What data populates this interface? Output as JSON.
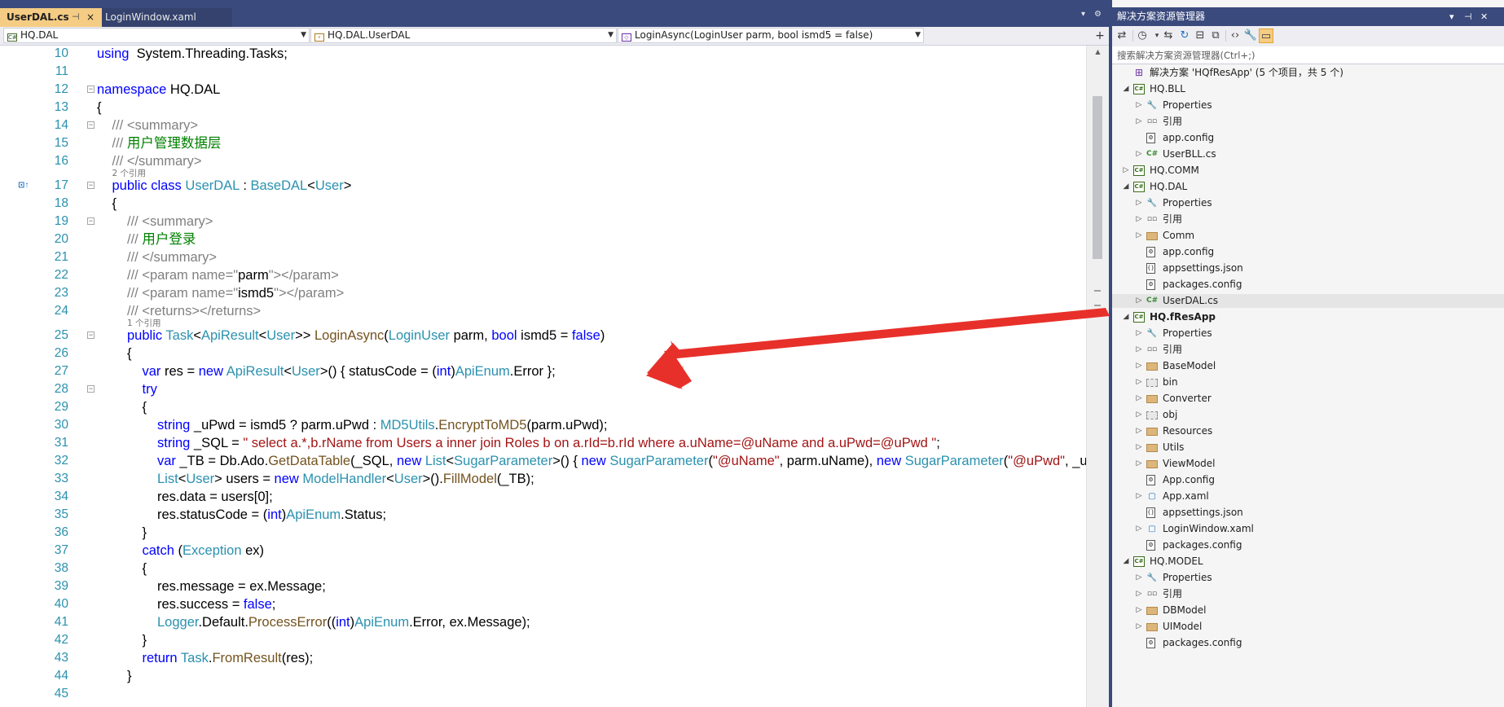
{
  "tabs": [
    {
      "label": "UserDAL.cs",
      "active": true,
      "pin": "⊣",
      "close": "×"
    },
    {
      "label": "LoginWindow.xaml",
      "active": false
    }
  ],
  "navbar": {
    "project": "HQ.DAL",
    "type": "HQ.DAL.UserDAL",
    "member": "LoginAsync(LoginUser parm, bool ismd5 = false)",
    "split_icon": "+"
  },
  "code_lines": [
    {
      "n": "10",
      "indent": 0,
      "tokens": [
        [
          "kw",
          "using"
        ],
        [
          "",
          "  System.Threading.Tasks;"
        ]
      ]
    },
    {
      "n": "11",
      "indent": 0,
      "tokens": []
    },
    {
      "n": "12",
      "indent": 0,
      "tokens": [
        [
          "kw",
          "namespace"
        ],
        [
          "",
          " HQ.DAL"
        ]
      ]
    },
    {
      "n": "13",
      "indent": 0,
      "tokens": [
        [
          "",
          "{"
        ]
      ]
    },
    {
      "n": "14",
      "indent": 1,
      "tokens": [
        [
          "doc",
          "/// "
        ],
        [
          "doc",
          "<summary>"
        ]
      ]
    },
    {
      "n": "15",
      "indent": 1,
      "tokens": [
        [
          "doc",
          "/// "
        ],
        [
          "cm",
          "用户管理数据层"
        ]
      ]
    },
    {
      "n": "16",
      "indent": 1,
      "tokens": [
        [
          "doc",
          "/// </summary>"
        ]
      ]
    },
    {
      "n": "17",
      "indent": 1,
      "tokens": [
        [
          "kw",
          "public"
        ],
        [
          "",
          " "
        ],
        [
          "kw",
          "class"
        ],
        [
          "",
          " "
        ],
        [
          "ty",
          "UserDAL"
        ],
        [
          "",
          " : "
        ],
        [
          "ty",
          "BaseDAL"
        ],
        [
          "",
          "<"
        ],
        [
          "ty",
          "User"
        ],
        [
          "",
          ">"
        ]
      ]
    },
    {
      "n": "18",
      "indent": 1,
      "tokens": [
        [
          "",
          "{"
        ]
      ]
    },
    {
      "n": "19",
      "indent": 2,
      "tokens": [
        [
          "doc",
          "/// <summary>"
        ]
      ]
    },
    {
      "n": "20",
      "indent": 2,
      "tokens": [
        [
          "doc",
          "/// "
        ],
        [
          "cm",
          "用户登录"
        ]
      ]
    },
    {
      "n": "21",
      "indent": 2,
      "tokens": [
        [
          "doc",
          "/// </summary>"
        ]
      ]
    },
    {
      "n": "22",
      "indent": 2,
      "tokens": [
        [
          "doc",
          "/// <param name=\""
        ],
        [
          "",
          "parm"
        ],
        [
          "doc",
          "\"></param>"
        ]
      ]
    },
    {
      "n": "23",
      "indent": 2,
      "tokens": [
        [
          "doc",
          "/// <param name=\""
        ],
        [
          "",
          "ismd5"
        ],
        [
          "doc",
          "\"></param>"
        ]
      ]
    },
    {
      "n": "24",
      "indent": 2,
      "tokens": [
        [
          "doc",
          "/// <returns></returns>"
        ]
      ]
    },
    {
      "n": "25",
      "indent": 2,
      "tokens": [
        [
          "kw",
          "public"
        ],
        [
          "",
          " "
        ],
        [
          "ty",
          "Task"
        ],
        [
          "",
          "<"
        ],
        [
          "ty",
          "ApiResult"
        ],
        [
          "",
          "<"
        ],
        [
          "ty",
          "User"
        ],
        [
          "",
          ">> "
        ],
        [
          "mt",
          "LoginAsync"
        ],
        [
          "",
          "("
        ],
        [
          "ty",
          "LoginUser"
        ],
        [
          "",
          " parm, "
        ],
        [
          "kw",
          "bool"
        ],
        [
          "",
          " ismd5 = "
        ],
        [
          "kw",
          "false"
        ],
        [
          "",
          ")"
        ]
      ]
    },
    {
      "n": "26",
      "indent": 2,
      "tokens": [
        [
          "",
          "{"
        ]
      ]
    },
    {
      "n": "27",
      "indent": 3,
      "tokens": [
        [
          "kw",
          "var"
        ],
        [
          "",
          " res = "
        ],
        [
          "kw",
          "new"
        ],
        [
          "",
          " "
        ],
        [
          "ty",
          "ApiResult"
        ],
        [
          "",
          "<"
        ],
        [
          "ty",
          "User"
        ],
        [
          "",
          ">() { statusCode = ("
        ],
        [
          "kw",
          "int"
        ],
        [
          "",
          ")"
        ],
        [
          "ty",
          "ApiEnum"
        ],
        [
          "",
          ".Error };"
        ]
      ]
    },
    {
      "n": "28",
      "indent": 3,
      "tokens": [
        [
          "kw",
          "try"
        ]
      ]
    },
    {
      "n": "29",
      "indent": 3,
      "tokens": [
        [
          "",
          "{"
        ]
      ]
    },
    {
      "n": "30",
      "indent": 4,
      "tokens": [
        [
          "kw",
          "string"
        ],
        [
          "",
          " _uPwd = ismd5 ? parm.uPwd : "
        ],
        [
          "ty",
          "MD5Utils"
        ],
        [
          "",
          "."
        ],
        [
          "mt",
          "EncryptToMD5"
        ],
        [
          "",
          "(parm.uPwd);"
        ]
      ]
    },
    {
      "n": "31",
      "indent": 4,
      "tokens": [
        [
          "kw",
          "string"
        ],
        [
          "",
          " _SQL = "
        ],
        [
          "st",
          "\" select a.*,b.rName from Users a inner join Roles b on a.rId=b.rId where a.uName=@uName and a.uPwd=@uPwd \""
        ],
        [
          "",
          ";"
        ]
      ]
    },
    {
      "n": "32",
      "indent": 4,
      "tokens": [
        [
          "kw",
          "var"
        ],
        [
          "",
          " _TB = Db.Ado."
        ],
        [
          "mt",
          "GetDataTable"
        ],
        [
          "",
          "(_SQL, "
        ],
        [
          "kw",
          "new"
        ],
        [
          "",
          " "
        ],
        [
          "ty",
          "List"
        ],
        [
          "",
          "<"
        ],
        [
          "ty",
          "SugarParameter"
        ],
        [
          "",
          ">() { "
        ],
        [
          "kw",
          "new"
        ],
        [
          "",
          " "
        ],
        [
          "ty",
          "SugarParameter"
        ],
        [
          "",
          "("
        ],
        [
          "st",
          "\"@uName\""
        ],
        [
          "",
          ", parm.uName), "
        ],
        [
          "kw",
          "new"
        ],
        [
          "",
          " "
        ],
        [
          "ty",
          "SugarParameter"
        ],
        [
          "",
          "("
        ],
        [
          "st",
          "\"@uPwd\""
        ],
        [
          "",
          ", _uPwd) });"
        ]
      ]
    },
    {
      "n": "33",
      "indent": 4,
      "tokens": [
        [
          "ty",
          "List"
        ],
        [
          "",
          "<"
        ],
        [
          "ty",
          "User"
        ],
        [
          "",
          "> users = "
        ],
        [
          "kw",
          "new"
        ],
        [
          "",
          " "
        ],
        [
          "ty",
          "ModelHandler"
        ],
        [
          "",
          "<"
        ],
        [
          "ty",
          "User"
        ],
        [
          "",
          ">()."
        ],
        [
          "mt",
          "FillModel"
        ],
        [
          "",
          "(_TB);"
        ]
      ]
    },
    {
      "n": "34",
      "indent": 4,
      "tokens": [
        [
          "",
          "res.data = users[0];"
        ]
      ]
    },
    {
      "n": "35",
      "indent": 4,
      "tokens": [
        [
          "",
          "res.statusCode = ("
        ],
        [
          "kw",
          "int"
        ],
        [
          "",
          ")"
        ],
        [
          "ty",
          "ApiEnum"
        ],
        [
          "",
          ".Status;"
        ]
      ]
    },
    {
      "n": "36",
      "indent": 3,
      "tokens": [
        [
          "",
          "}"
        ]
      ]
    },
    {
      "n": "37",
      "indent": 3,
      "tokens": [
        [
          "kw",
          "catch"
        ],
        [
          "",
          " ("
        ],
        [
          "ty",
          "Exception"
        ],
        [
          "",
          " ex)"
        ]
      ]
    },
    {
      "n": "38",
      "indent": 3,
      "tokens": [
        [
          "",
          "{"
        ]
      ]
    },
    {
      "n": "39",
      "indent": 4,
      "tokens": [
        [
          "",
          "res.message = ex.Message;"
        ]
      ]
    },
    {
      "n": "40",
      "indent": 4,
      "tokens": [
        [
          "",
          "res.success = "
        ],
        [
          "kw",
          "false"
        ],
        [
          "",
          ";"
        ]
      ]
    },
    {
      "n": "41",
      "indent": 4,
      "tokens": [
        [
          "ty",
          "Logger"
        ],
        [
          "",
          ".Default."
        ],
        [
          "mt",
          "ProcessError"
        ],
        [
          "",
          "(("
        ],
        [
          "kw",
          "int"
        ],
        [
          "",
          ")"
        ],
        [
          "ty",
          "ApiEnum"
        ],
        [
          "",
          ".Error, ex.Message);"
        ]
      ]
    },
    {
      "n": "42",
      "indent": 3,
      "tokens": [
        [
          "",
          "}"
        ]
      ]
    },
    {
      "n": "43",
      "indent": 3,
      "tokens": [
        [
          "kw",
          "return"
        ],
        [
          "",
          " "
        ],
        [
          "ty",
          "Task"
        ],
        [
          "",
          "."
        ],
        [
          "mt",
          "FromResult"
        ],
        [
          "",
          "(res);"
        ]
      ]
    },
    {
      "n": "44",
      "indent": 2,
      "tokens": [
        [
          "",
          "}"
        ]
      ]
    },
    {
      "n": "45",
      "indent": 0,
      "tokens": []
    }
  ],
  "codelens": [
    {
      "after": "16",
      "text": "2 个引用"
    },
    {
      "after": "24",
      "text": "1 个引用"
    }
  ],
  "solution_explorer": {
    "title": "解决方案资源管理器",
    "search_placeholder": "搜索解决方案资源管理器(Ctrl+;)",
    "tree": [
      {
        "level": 0,
        "expander": "",
        "icon": "solution",
        "label": "解决方案 'HQfResApp' (5 个项目，共 5 个)"
      },
      {
        "level": 0,
        "expander": "expanded",
        "icon": "project",
        "label": "HQ.BLL"
      },
      {
        "level": 1,
        "expander": "collapsed",
        "icon": "wrench",
        "label": "Properties"
      },
      {
        "level": 1,
        "expander": "collapsed",
        "icon": "references",
        "label": "引用"
      },
      {
        "level": 1,
        "expander": "",
        "icon": "config",
        "label": "app.config"
      },
      {
        "level": 1,
        "expander": "collapsed",
        "icon": "csharp",
        "label": "UserBLL.cs"
      },
      {
        "level": 0,
        "expander": "collapsed",
        "icon": "project",
        "label": "HQ.COMM"
      },
      {
        "level": 0,
        "expander": "expanded",
        "icon": "project",
        "label": "HQ.DAL"
      },
      {
        "level": 1,
        "expander": "collapsed",
        "icon": "wrench",
        "label": "Properties"
      },
      {
        "level": 1,
        "expander": "collapsed",
        "icon": "references",
        "label": "引用"
      },
      {
        "level": 1,
        "expander": "collapsed",
        "icon": "folder",
        "label": "Comm"
      },
      {
        "level": 1,
        "expander": "",
        "icon": "config",
        "label": "app.config"
      },
      {
        "level": 1,
        "expander": "",
        "icon": "json",
        "label": "appsettings.json"
      },
      {
        "level": 1,
        "expander": "",
        "icon": "config",
        "label": "packages.config"
      },
      {
        "level": 1,
        "expander": "collapsed",
        "icon": "csharp",
        "label": "UserDAL.cs",
        "selected": true
      },
      {
        "level": 0,
        "expander": "expanded",
        "icon": "project",
        "label": "HQ.fResApp",
        "bold": true
      },
      {
        "level": 1,
        "expander": "collapsed",
        "icon": "wrench",
        "label": "Properties"
      },
      {
        "level": 1,
        "expander": "collapsed",
        "icon": "references",
        "label": "引用"
      },
      {
        "level": 1,
        "expander": "collapsed",
        "icon": "folder",
        "label": "BaseModel"
      },
      {
        "level": 1,
        "expander": "collapsed",
        "icon": "folder-excluded",
        "label": "bin"
      },
      {
        "level": 1,
        "expander": "collapsed",
        "icon": "folder",
        "label": "Converter"
      },
      {
        "level": 1,
        "expander": "collapsed",
        "icon": "folder-excluded",
        "label": "obj"
      },
      {
        "level": 1,
        "expander": "collapsed",
        "icon": "folder",
        "label": "Resources"
      },
      {
        "level": 1,
        "expander": "collapsed",
        "icon": "folder",
        "label": "Utils"
      },
      {
        "level": 1,
        "expander": "collapsed",
        "icon": "folder",
        "label": "ViewModel"
      },
      {
        "level": 1,
        "expander": "",
        "icon": "config",
        "label": "App.config"
      },
      {
        "level": 1,
        "expander": "collapsed",
        "icon": "xaml",
        "label": "App.xaml"
      },
      {
        "level": 1,
        "expander": "",
        "icon": "json",
        "label": "appsettings.json"
      },
      {
        "level": 1,
        "expander": "collapsed",
        "icon": "xaml",
        "label": "LoginWindow.xaml"
      },
      {
        "level": 1,
        "expander": "",
        "icon": "config",
        "label": "packages.config"
      },
      {
        "level": 0,
        "expander": "expanded",
        "icon": "project",
        "label": "HQ.MODEL"
      },
      {
        "level": 1,
        "expander": "collapsed",
        "icon": "wrench",
        "label": "Properties"
      },
      {
        "level": 1,
        "expander": "collapsed",
        "icon": "references",
        "label": "引用"
      },
      {
        "level": 1,
        "expander": "collapsed",
        "icon": "folder",
        "label": "DBModel"
      },
      {
        "level": 1,
        "expander": "collapsed",
        "icon": "folder",
        "label": "UIModel"
      },
      {
        "level": 1,
        "expander": "",
        "icon": "config",
        "label": "packages.config"
      }
    ]
  },
  "colors": {
    "keyword": "#0000ff",
    "type": "#2b91af",
    "comment": "#008000",
    "string": "#a31515",
    "accent_tab": "#f5cc84",
    "chrome": "#3a4a7c",
    "annotation_arrow": "#e8302a"
  }
}
